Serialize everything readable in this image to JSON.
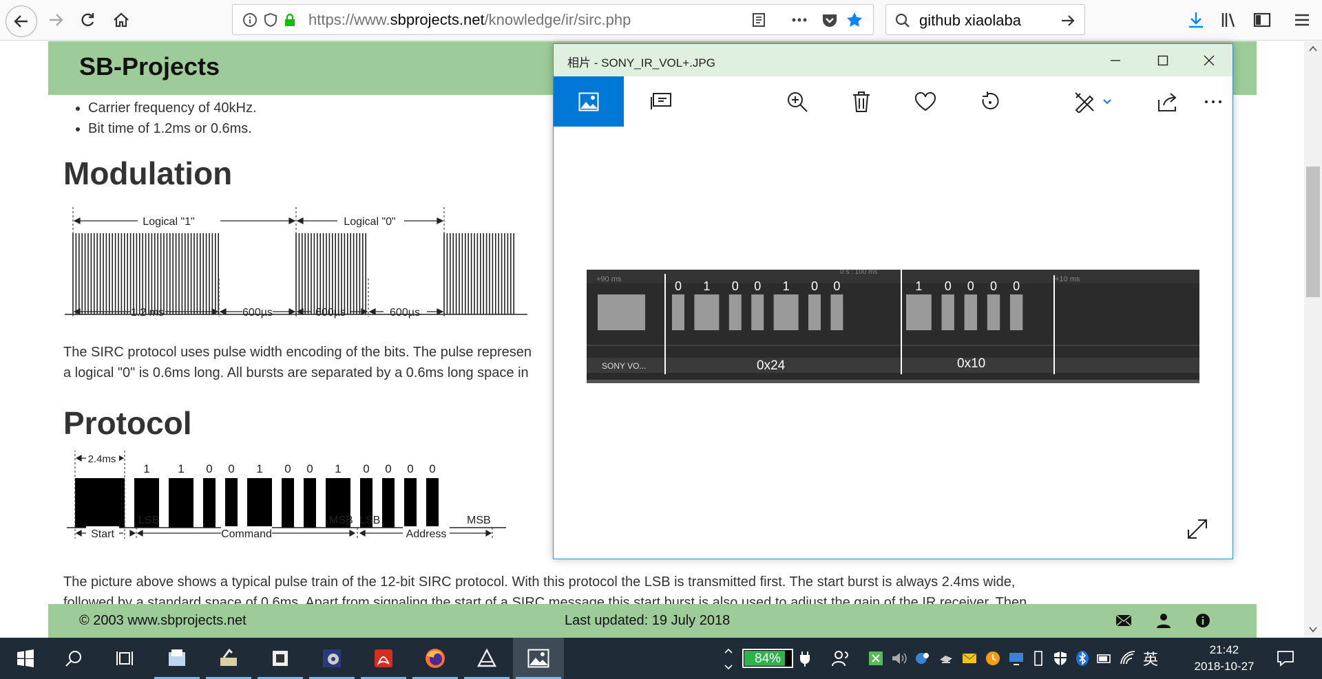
{
  "browser": {
    "url_prefix": "https://www.",
    "url_domain": "sbprojects.net",
    "url_path": "/knowledge/ir/sirc.php",
    "search_text": "github xiaolaba"
  },
  "page": {
    "site_title": "SB-Projects",
    "bullets": [
      "Carrier frequency of 40kHz.",
      "Bit time of 1.2ms or 0.6ms."
    ],
    "h_modulation": "Modulation",
    "modulation_labels": {
      "logical1": "Logical \"1\"",
      "logical0": "Logical \"0\"",
      "t12": "1.2 ms",
      "t600a": "600µs",
      "t600b": "600µs",
      "t600c": "600µs"
    },
    "para1_line1": "The SIRC protocol uses pulse width encoding of the bits. The pulse represen",
    "para1_line2": "a logical \"0\" is 0.6ms long. All bursts are separated by a 0.6ms long space in",
    "h_protocol": "Protocol",
    "protocol_labels": {
      "start_width": "2.4ms",
      "bits": [
        "1",
        "1",
        "0",
        "0",
        "1",
        "0",
        "0",
        "1",
        "0",
        "0",
        "0",
        "0"
      ],
      "lsb1": "LSB",
      "msb1": "MSB",
      "lsb2": "LSB",
      "msb2": "MSB",
      "start": "Start",
      "command": "Command",
      "address": "Address"
    },
    "para2_line1": "The picture above shows a typical pulse train of the 12-bit SIRC protocol. With this protocol the LSB is transmitted first. The start burst is always 2.4ms wide,",
    "para2_line2": "followed by a standard space of 0.6ms. Apart from signaling the start of a SIRC message this start burst is also used to adjust the gain of the IR receiver. Then",
    "footer_copyright": "© 2003 www.sbprojects.net",
    "footer_updated": "Last updated: 19 July 2018"
  },
  "photos_window": {
    "title": "相片 - SONY_IR_VOL+.JPG",
    "capture": {
      "left_time": "+90 ms",
      "center_time": "0 s : 100 ms",
      "right_time": "+10 ms",
      "bits_cmd": [
        "0",
        "1",
        "0",
        "0",
        "1",
        "0",
        "0"
      ],
      "bits_addr": [
        "1",
        "0",
        "0",
        "0",
        "0"
      ],
      "channel": "SONY VO...",
      "hex_cmd": "0x24",
      "hex_addr": "0x10"
    }
  },
  "taskbar": {
    "battery": "84%",
    "ime": "英",
    "time": "21:42",
    "date": "2018-10-27"
  }
}
